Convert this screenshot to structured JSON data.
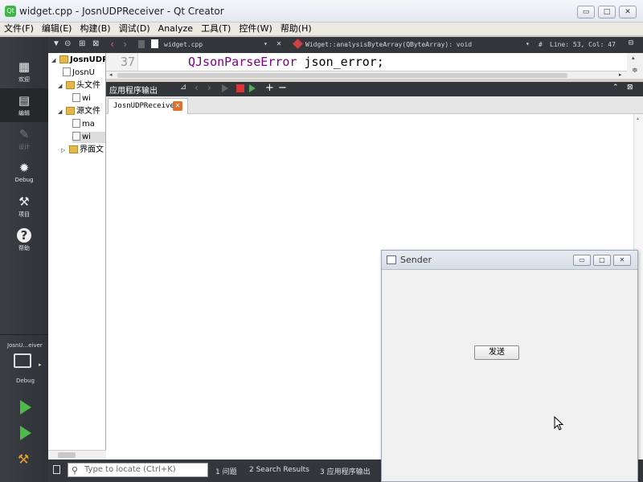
{
  "window": {
    "title": "widget.cpp - JosnUDPReceiver - Qt Creator",
    "app_icon": "qt-logo",
    "controls": {
      "minimize": "▭",
      "maximize": "□",
      "close": "✕"
    }
  },
  "menubar": {
    "items": [
      "文件(F)",
      "编辑(E)",
      "构建(B)",
      "调试(D)",
      "Analyze",
      "工具(T)",
      "控件(W)",
      "帮助(H)"
    ]
  },
  "modebar": {
    "items": [
      {
        "label": "欢迎",
        "icon": "grid-icon",
        "glyph": "▦",
        "state": "normal"
      },
      {
        "label": "编辑",
        "icon": "edit-icon",
        "glyph": "▤",
        "state": "active"
      },
      {
        "label": "设计",
        "icon": "design-icon",
        "glyph": "✎",
        "state": "disabled"
      },
      {
        "label": "Debug",
        "icon": "bug-icon",
        "glyph": "✹",
        "state": "normal"
      },
      {
        "label": "项目",
        "icon": "wrench-icon",
        "glyph": "⚒",
        "state": "normal"
      },
      {
        "label": "帮助",
        "icon": "help-icon",
        "glyph": "?",
        "state": "normal"
      }
    ],
    "target_project": "JosnU...eiver",
    "target_mode": "Debug"
  },
  "project_tree": {
    "rows": [
      {
        "text": "JosnUDP",
        "arrow": "◢",
        "kind": "project",
        "bold": true
      },
      {
        "text": "JosnU",
        "arrow": "",
        "kind": "file"
      },
      {
        "text": "头文件",
        "arrow": "◢",
        "kind": "folder"
      },
      {
        "text": "wi",
        "arrow": "",
        "kind": "file"
      },
      {
        "text": "源文件",
        "arrow": "◢",
        "kind": "folder"
      },
      {
        "text": "ma",
        "arrow": "",
        "kind": "file"
      },
      {
        "text": "wi",
        "arrow": "",
        "kind": "file"
      },
      {
        "text": "界面文",
        "arrow": "▷",
        "kind": "folder"
      }
    ]
  },
  "editor_toolbar": {
    "file": "widget.cpp",
    "symbol": "Widget::analysisByteArray(QByteArray): void",
    "hash": "#",
    "position": "Line: 53, Col: 47"
  },
  "editor": {
    "line_number": "37",
    "code_type": "QJsonParseError",
    "code_rest": " json_error;"
  },
  "output_pane": {
    "title": "应用程序输出",
    "tab_label": "JosnUDPReceiver",
    "tab_close": "✕"
  },
  "statusbar": {
    "locator_placeholder": "Type to locate (Ctrl+K)",
    "tabs": [
      "1 问题",
      "2 Search Results",
      "3 应用程序输出"
    ]
  },
  "sender": {
    "title": "Sender",
    "button": "发送"
  }
}
